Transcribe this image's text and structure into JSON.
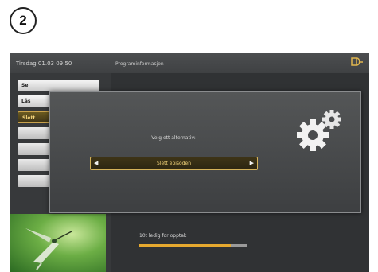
{
  "step": "2",
  "topbar": {
    "datetime": "Tirsdag 01.03 09:50",
    "section_title": "Programinformasjon"
  },
  "menu": {
    "items": [
      {
        "label": "Se",
        "state": "normal"
      },
      {
        "label": "Lås",
        "state": "normal"
      },
      {
        "label": "Slett",
        "state": "active"
      },
      {
        "label": "",
        "state": "empty"
      },
      {
        "label": "",
        "state": "empty"
      },
      {
        "label": "",
        "state": "empty"
      },
      {
        "label": "",
        "state": "empty"
      }
    ]
  },
  "dialog": {
    "prompt": "Velg ett alternativ:",
    "selected_option": "Slett episoden",
    "icon": "gears-icon"
  },
  "storage": {
    "label": "10t ledig for opptak",
    "used_fraction": 0.85
  },
  "colors": {
    "accent": "#e6a92f",
    "highlight_text": "#f2d37a",
    "screen_bg": "#37393b"
  }
}
